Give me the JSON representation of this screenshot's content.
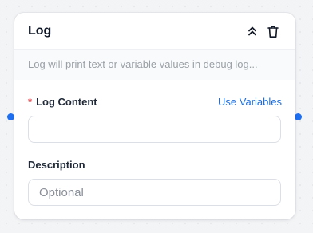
{
  "node": {
    "title": "Log",
    "description": "Log will print text or variable values in debug log...",
    "collapse_icon": "chevrons-up-icon",
    "delete_icon": "trash-icon"
  },
  "fields": {
    "log_content": {
      "required_mark": "*",
      "label": "Log Content",
      "use_variables_label": "Use Variables",
      "value": "",
      "placeholder": ""
    },
    "description": {
      "label": "Description",
      "value": "",
      "placeholder": "Optional"
    }
  },
  "colors": {
    "accent": "#1d6fe0",
    "port": "#1f6ff2",
    "required": "#e5484d"
  }
}
